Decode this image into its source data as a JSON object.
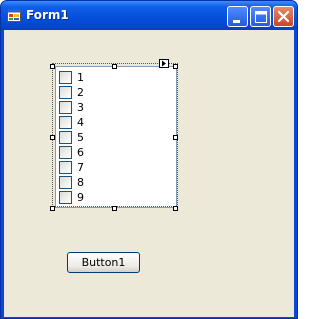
{
  "window": {
    "title": "Form1",
    "caption_buttons": [
      "minimize-icon",
      "maximize-icon",
      "close-icon"
    ],
    "colors": {
      "titlebar": "#0650dc",
      "client": "#ece9d8",
      "close": "#c8452a"
    }
  },
  "checked_list_box": {
    "items": [
      {
        "label": "1",
        "checked": false
      },
      {
        "label": "2",
        "checked": false
      },
      {
        "label": "3",
        "checked": false
      },
      {
        "label": "4",
        "checked": false
      },
      {
        "label": "5",
        "checked": false
      },
      {
        "label": "6",
        "checked": false
      },
      {
        "label": "7",
        "checked": false
      },
      {
        "label": "8",
        "checked": false
      },
      {
        "label": "9",
        "checked": false
      }
    ]
  },
  "button1": {
    "label": "Button1"
  }
}
